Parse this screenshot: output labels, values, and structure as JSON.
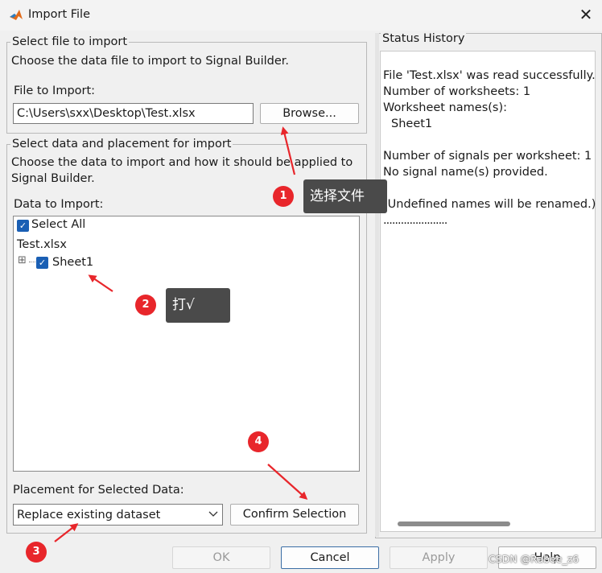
{
  "window": {
    "title": "Import File",
    "close_glyph": "✕"
  },
  "select_file": {
    "group_title": "Select file to import",
    "description": "Choose the data file to import to Signal Builder.",
    "file_label": "File to Import:",
    "file_value": "C:\\Users\\sxx\\Desktop\\Test.xlsx",
    "browse_label": "Browse..."
  },
  "select_data": {
    "group_title": "Select data and placement for import",
    "description_line1": "Choose the data to import and how it should be applied to",
    "description_line2": "Signal Builder.",
    "data_label": "Data to Import:",
    "select_all_label": "Select All",
    "file_node": "Test.xlsx",
    "sheet_node": "Sheet1",
    "expand_glyph": "⊞",
    "check_glyph": "✓"
  },
  "placement": {
    "label": "Placement for Selected Data:",
    "selected": "Replace existing dataset",
    "confirm_label": "Confirm Selection"
  },
  "status": {
    "title": "Status History",
    "lines": [
      "File 'Test.xlsx' was read successfully.",
      "Number of worksheets: 1",
      "Worksheet names(s):",
      "  Sheet1",
      "",
      "Number of signals per worksheet: 1",
      "No signal name(s) provided.",
      "",
      "(Undefined names will be renamed.)",
      "......................"
    ]
  },
  "footer": {
    "ok_label": "OK",
    "cancel_label": "Cancel",
    "apply_label": "Apply",
    "help_label": "Help"
  },
  "annotations": {
    "badge1": "1",
    "tip1": "选择文件",
    "badge2": "2",
    "tip2": "打√",
    "badge3": "3",
    "badge4": "4",
    "accent": "#e8262b"
  },
  "watermark": "CSDN @Rabee_z6",
  "icons": {
    "app": "matlab-logo-icon",
    "dropdown": "chevron-down-icon"
  }
}
